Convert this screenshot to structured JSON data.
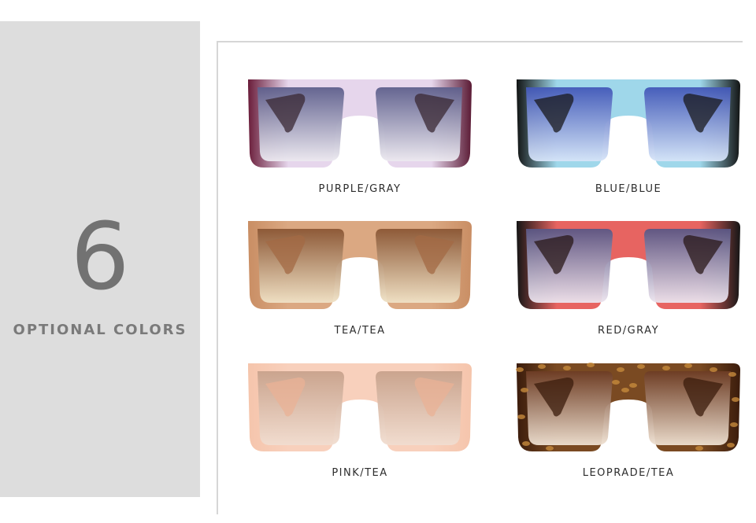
{
  "side_panel": {
    "count": "6",
    "label": "OPTIONAL COLORS"
  },
  "products": [
    {
      "label": "PURPLE/GRAY",
      "frame_left": "#6a1d3a",
      "frame_mid": "#e6d6ec",
      "frame_right": "#5a1a34",
      "lens_top": "#5e5f8c",
      "lens_bottom": "#ece9f0",
      "temple": "#3a2833"
    },
    {
      "label": "BLUE/BLUE",
      "frame_left": "#121414",
      "frame_mid": "#9fd7ea",
      "frame_right": "#121414",
      "lens_top": "#4258b8",
      "lens_bottom": "#d6e4f8",
      "temple": "#1a1a1c"
    },
    {
      "label": "TEA/TEA",
      "frame_left": "#c98e64",
      "frame_mid": "#dba882",
      "frame_right": "#c98e64",
      "lens_top": "#8a5634",
      "lens_bottom": "#f0e2c6",
      "temple": "#a36a44"
    },
    {
      "label": "RED/GRAY",
      "frame_left": "#161616",
      "frame_mid": "#e76461",
      "frame_right": "#161616",
      "lens_top": "#5a5684",
      "lens_bottom": "#ece4ee",
      "temple": "#2a1818"
    },
    {
      "label": "PINK/TEA",
      "frame_left": "#f5c5ac",
      "frame_mid": "#f8d0bc",
      "frame_right": "#f5c5ac",
      "lens_top": "#c8a28c",
      "lens_bottom": "#f1ddd0",
      "temple": "#eab196"
    },
    {
      "label": "LEOPRADE/TEA",
      "frame_left": "#3b1c0c",
      "frame_mid": "#7a4a22",
      "frame_right": "#3b1c0c",
      "lens_top": "#6d3c24",
      "lens_bottom": "#efe1d2",
      "temple": "#3b1c0c"
    }
  ]
}
